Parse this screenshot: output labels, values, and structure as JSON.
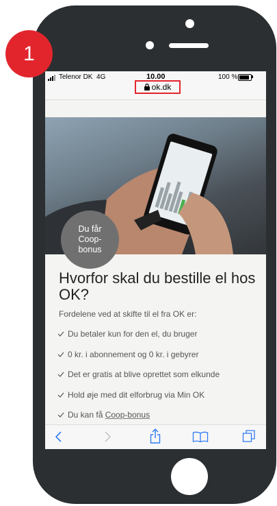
{
  "step_badge": "1",
  "statusbar": {
    "carrier": "Telenor DK",
    "network": "4G",
    "time": "10.00",
    "battery": "100 %"
  },
  "browser": {
    "url": "ok.dk"
  },
  "hero": {
    "badge_lines": [
      "Du får",
      "Coop-",
      "bonus"
    ]
  },
  "content": {
    "title": "Hvorfor skal du bestille el hos OK?",
    "intro": "Fordelene ved at skifte til el fra OK er:",
    "benefits": [
      "Du betaler kun for den el, du bruger",
      "0 kr. i abonnement og 0 kr. i gebyrer",
      "Det er gratis at blive oprettet som elkunde",
      "Hold øje med dit elforbrug via Min OK"
    ],
    "last_benefit_prefix": "Du kan få",
    "last_benefit_link": "Coop-bonus"
  },
  "toolbar_icons": [
    "back-icon",
    "forward-icon",
    "share-icon",
    "bookmarks-icon",
    "tabs-icon"
  ],
  "colors": {
    "highlight_red": "#e2252d",
    "phone_body": "#2b2f31",
    "ios_blue": "#2f7cf6"
  }
}
